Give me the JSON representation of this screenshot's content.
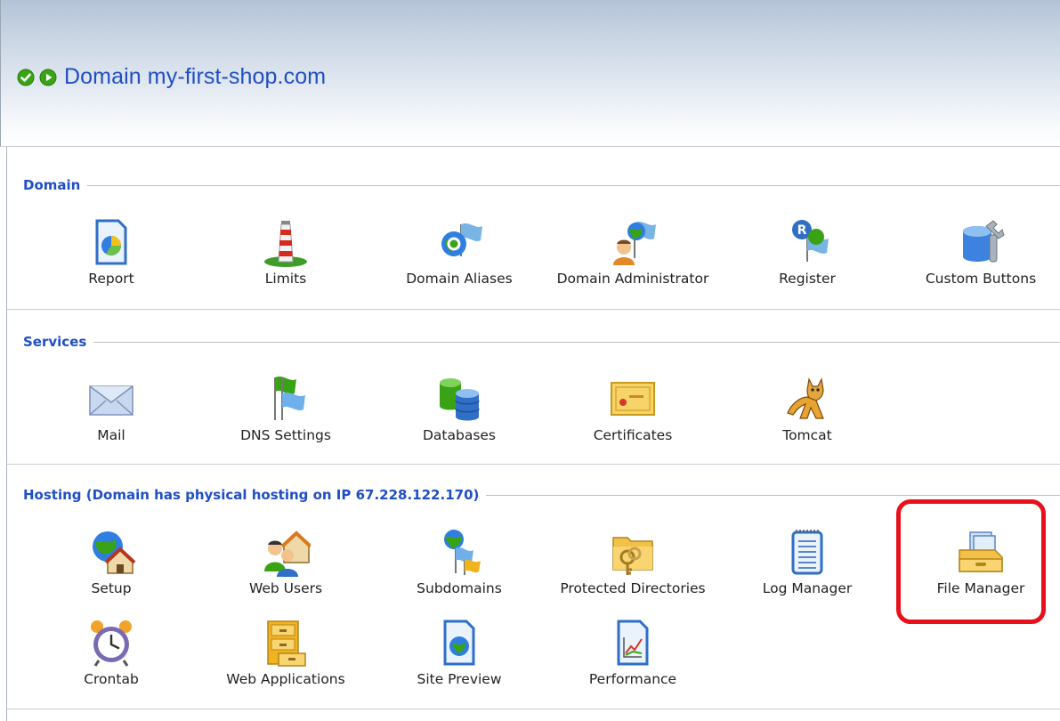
{
  "header": {
    "title": "Domain my-first-shop.com",
    "status_icons": [
      "check-circle-icon",
      "play-circle-icon"
    ]
  },
  "sections": [
    {
      "title": "Domain",
      "tools": [
        {
          "label": "Report",
          "icon": "report-icon"
        },
        {
          "label": "Limits",
          "icon": "limits-icon"
        },
        {
          "label": "Domain Aliases",
          "icon": "domain-aliases-icon"
        },
        {
          "label": "Domain Administrator",
          "icon": "domain-administrator-icon"
        },
        {
          "label": "Register",
          "icon": "register-icon"
        },
        {
          "label": "Custom Buttons",
          "icon": "custom-buttons-icon"
        }
      ]
    },
    {
      "title": "Services",
      "tools": [
        {
          "label": "Mail",
          "icon": "mail-icon"
        },
        {
          "label": "DNS Settings",
          "icon": "dns-settings-icon"
        },
        {
          "label": "Databases",
          "icon": "databases-icon"
        },
        {
          "label": "Certificates",
          "icon": "certificates-icon"
        },
        {
          "label": "Tomcat",
          "icon": "tomcat-icon"
        }
      ]
    },
    {
      "title": "Hosting (Domain has physical hosting on IP 67.228.122.170)",
      "tools": [
        {
          "label": "Setup",
          "icon": "setup-icon"
        },
        {
          "label": "Web Users",
          "icon": "web-users-icon"
        },
        {
          "label": "Subdomains",
          "icon": "subdomains-icon"
        },
        {
          "label": "Protected Directories",
          "icon": "protected-directories-icon"
        },
        {
          "label": "Log Manager",
          "icon": "log-manager-icon"
        },
        {
          "label": "File Manager",
          "icon": "file-manager-icon"
        },
        {
          "label": "Crontab",
          "icon": "crontab-icon"
        },
        {
          "label": "Web Applications",
          "icon": "web-applications-icon"
        },
        {
          "label": "Site Preview",
          "icon": "site-preview-icon"
        },
        {
          "label": "Performance",
          "icon": "performance-icon"
        }
      ]
    }
  ],
  "colors": {
    "accent": "#1f4fc4",
    "highlight": "#e8111b",
    "header_top": "#b3c3d6"
  }
}
